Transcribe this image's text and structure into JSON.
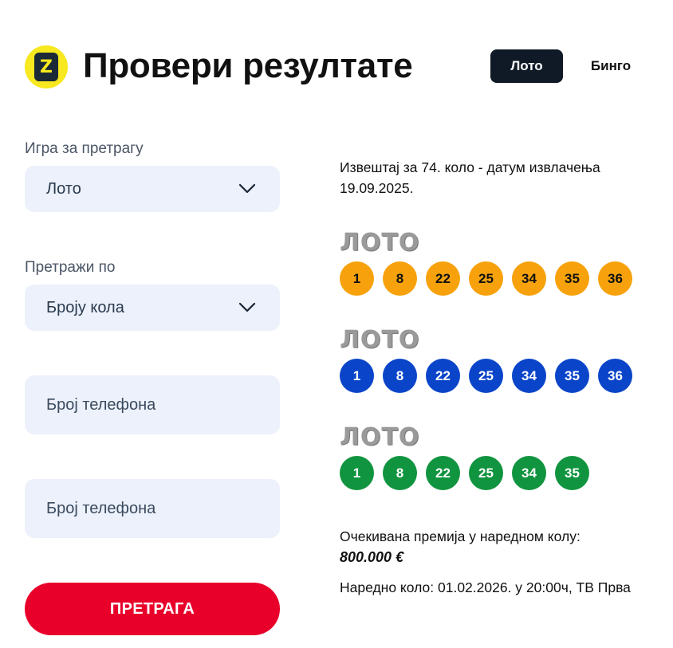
{
  "header": {
    "logo_text": "Z",
    "title": "Провери резултате",
    "tabs": [
      {
        "label": "Лото",
        "active": true
      },
      {
        "label": "Бинго",
        "active": false
      }
    ]
  },
  "form": {
    "game": {
      "label": "Игра за претрагу",
      "value": "Лото"
    },
    "search_by": {
      "label": "Претражи по",
      "value": "Броју кола"
    },
    "phone_1": {
      "placeholder": "Број телефона"
    },
    "phone_2": {
      "placeholder": "Број телефона"
    },
    "submit_label": "ПРЕТРАГА"
  },
  "results": {
    "report": "Извештај за 74. коло - датум извлачења 19.09.2025.",
    "draws": [
      {
        "logo": "ЛОТО",
        "color": "#f7a20d",
        "numbers": [
          "1",
          "8",
          "22",
          "25",
          "34",
          "35",
          "36"
        ]
      },
      {
        "logo": "ЛОТО",
        "color": "#0a45c9",
        "numbers": [
          "1",
          "8",
          "22",
          "25",
          "34",
          "35",
          "36"
        ]
      },
      {
        "logo": "ЛОТО",
        "color": "#11943f",
        "numbers": [
          "1",
          "8",
          "22",
          "25",
          "34",
          "35"
        ]
      }
    ],
    "expected_prize_label": "Очекивана премија у наредном колу:",
    "expected_prize_value": "800.000 €",
    "next_draw": "Наредно коло: 01.02.2026. у 20:00ч, ТВ Прва"
  },
  "colors": {
    "accent_red": "#e8002a",
    "tab_active_bg": "#0f1a26",
    "logo_yellow": "#f7e81f",
    "field_bg": "#ecf1fb"
  },
  "icons": [
    "chevron-down-icon",
    "brand-logo"
  ]
}
